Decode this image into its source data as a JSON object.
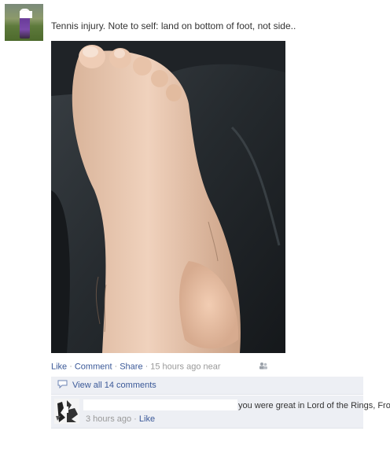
{
  "post": {
    "status_text": "Tennis injury. Note to self: land on bottom of foot, not side..",
    "actions": {
      "like": "Like",
      "comment": "Comment",
      "share": "Share",
      "separator": "·",
      "time": "15 hours ago near"
    },
    "icons": {
      "tagged_people": "people-tag-icon",
      "comment_bubble": "comment-bubble-icon"
    }
  },
  "comments": {
    "view_all_label": "View all 14 comments",
    "items": [
      {
        "text": "you were great in Lord of the Rings, Frodo",
        "time": "3 hours ago",
        "separator": "·",
        "like_label": "Like"
      }
    ]
  },
  "colors": {
    "link": "#3b5998",
    "muted": "#999999",
    "ufi_background": "#edeff4"
  }
}
